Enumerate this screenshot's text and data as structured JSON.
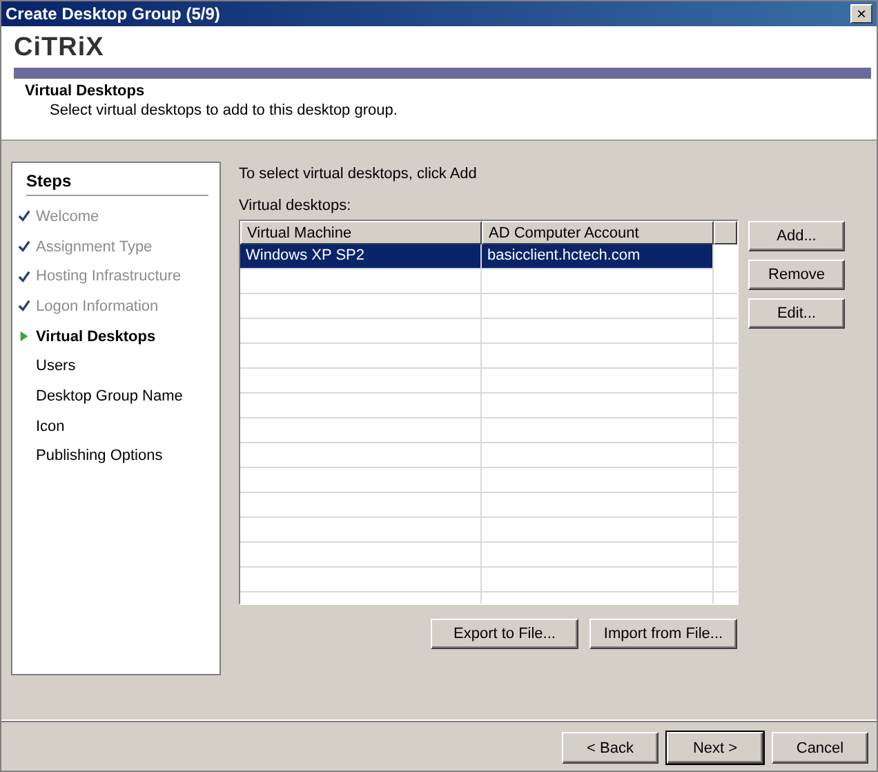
{
  "window": {
    "title": "Create Desktop Group (5/9)",
    "close": "×"
  },
  "header": {
    "logo": "CiTRiX",
    "title": "Virtual Desktops",
    "subtitle": "Select virtual desktops to add to this desktop group."
  },
  "steps": {
    "heading": "Steps",
    "items": [
      {
        "label": "Welcome",
        "kind": "done"
      },
      {
        "label": "Assignment Type",
        "kind": "done"
      },
      {
        "label": "Hosting Infrastructure",
        "kind": "done"
      },
      {
        "label": "Logon Information",
        "kind": "done"
      },
      {
        "label": "Virtual Desktops",
        "kind": "current"
      },
      {
        "label": "Users",
        "kind": "pending"
      },
      {
        "label": "Desktop Group Name",
        "kind": "pending"
      },
      {
        "label": "Icon",
        "kind": "pending"
      },
      {
        "label": "Publishing Options",
        "kind": "pending"
      }
    ]
  },
  "instruction": "To select virtual desktops, click Add",
  "list_label": "Virtual desktops:",
  "table": {
    "columns": [
      "Virtual Machine",
      "AD Computer Account"
    ],
    "rows": [
      {
        "cells": [
          "Windows XP SP2",
          "basicclient.hctech.com"
        ],
        "selected": true
      }
    ]
  },
  "side_buttons": [
    "Add...",
    "Remove",
    "Edit..."
  ],
  "file_buttons": [
    "Export to File...",
    "Import from File..."
  ],
  "footer_buttons": [
    {
      "label": "< Back",
      "default": false
    },
    {
      "label": "Next >",
      "default": true
    },
    {
      "label": "Cancel",
      "default": false
    }
  ]
}
